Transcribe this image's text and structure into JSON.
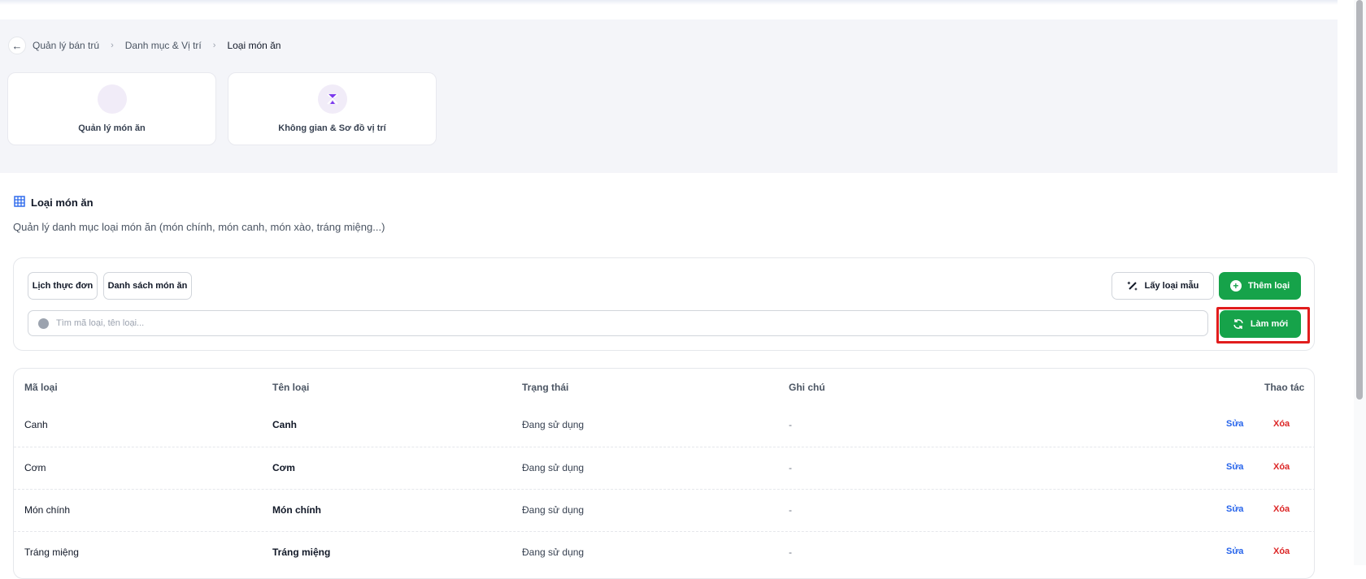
{
  "breadcrumb": {
    "items": [
      "Quản lý bán trú",
      "Danh mục & Vị trí"
    ],
    "current": "Loại món ăn"
  },
  "modules": [
    {
      "label": "Quản lý món ăn",
      "icon": "dish-icon"
    },
    {
      "label": "Không gian & Sơ đồ vị trí",
      "icon": "layout-map-icon"
    }
  ],
  "section": {
    "title": "Loại món ăn",
    "description": "Quản lý danh mục loại món ăn (món chính, món canh, món xào, tráng miệng...)"
  },
  "toolbar": {
    "tab_menu_schedule": "Lịch thực đơn",
    "tab_dish_list": "Danh sách món ăn",
    "sample_button": "Lấy loại mẫu",
    "add_button": "Thêm loại",
    "refresh_button": "Làm mới",
    "search_placeholder": "Tìm mã loại, tên loại...",
    "search_value": ""
  },
  "table": {
    "headers": {
      "code": "Mã loại",
      "name": "Tên loại",
      "status": "Trạng thái",
      "note": "Ghi chú",
      "actions": "Thao tác"
    },
    "edit_label": "Sửa",
    "delete_label": "Xóa",
    "rows": [
      {
        "code": "Canh",
        "name": "Canh",
        "status": "Đang sử dụng",
        "note": "-"
      },
      {
        "code": "Cơm",
        "name": "Cơm",
        "status": "Đang sử dụng",
        "note": "-"
      },
      {
        "code": "Món chính",
        "name": "Món chính",
        "status": "Đang sử dụng",
        "note": "-"
      },
      {
        "code": "Tráng miệng",
        "name": "Tráng miệng",
        "status": "Đang sử dụng",
        "note": "-"
      }
    ]
  },
  "colors": {
    "accent_green": "#16a34a",
    "highlight_red": "#e11d1d",
    "edit_blue": "#2563eb",
    "delete_red": "#dc2626",
    "module_icon_purple": "#7c3aed"
  }
}
